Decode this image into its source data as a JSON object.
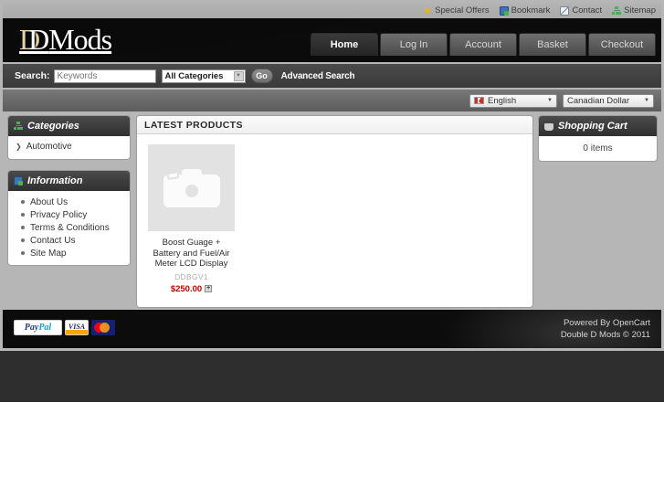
{
  "header": {
    "logo": {
      "d1": "D",
      "d2": "D",
      "rest": "Mods"
    },
    "top_links": [
      {
        "label": "Special Offers",
        "icon": "star-icon"
      },
      {
        "label": "Bookmark",
        "icon": "bookmark-icon"
      },
      {
        "label": "Contact",
        "icon": "mail-icon"
      },
      {
        "label": "Sitemap",
        "icon": "sitemap-icon"
      }
    ],
    "nav": [
      {
        "label": "Home",
        "active": true
      },
      {
        "label": "Log In",
        "active": false
      },
      {
        "label": "Account",
        "active": false
      },
      {
        "label": "Basket",
        "active": false
      },
      {
        "label": "Checkout",
        "active": false
      }
    ]
  },
  "search": {
    "label": "Search:",
    "placeholder": "Keywords",
    "value": "",
    "category_selected": "All Categories",
    "go_label": "Go",
    "advanced_label": "Advanced Search"
  },
  "locale": {
    "language": "English",
    "currency": "Canadian Dollar"
  },
  "sidebar": {
    "categories": {
      "title": "Categories",
      "icon": "sitemap-icon",
      "items": [
        {
          "label": "Automotive"
        }
      ]
    },
    "information": {
      "title": "Information",
      "icon": "book-icon",
      "items": [
        {
          "label": "About Us"
        },
        {
          "label": "Privacy Policy"
        },
        {
          "label": "Terms & Conditions"
        },
        {
          "label": "Contact Us"
        },
        {
          "label": "Site Map"
        }
      ]
    }
  },
  "main": {
    "latest_products": {
      "title": "LATEST PRODUCTS",
      "products": [
        {
          "name": "Boost Guage + Battery and Fuel/Air Meter LCD Display",
          "model": "DDBGV1",
          "price": "$250.00",
          "image": "camera-placeholder-icon"
        }
      ]
    }
  },
  "cart": {
    "title": "Shopping Cart",
    "icon": "cart-icon",
    "items_text": "0 items"
  },
  "footer": {
    "payment_icons": [
      "paypal-logo",
      "visa-logo",
      "mastercard-logo"
    ],
    "paypal_label_a": "Pay",
    "paypal_label_b": "Pal",
    "visa_label": "VISA",
    "powered_by": "Powered By OpenCart",
    "copyright": "Double D Mods © 2011"
  },
  "colors": {
    "accent_gold": "#e8d6a8",
    "price_red": "#c00000",
    "header_black": "#0b0b0b",
    "page_grey": "#b6b6b6"
  }
}
